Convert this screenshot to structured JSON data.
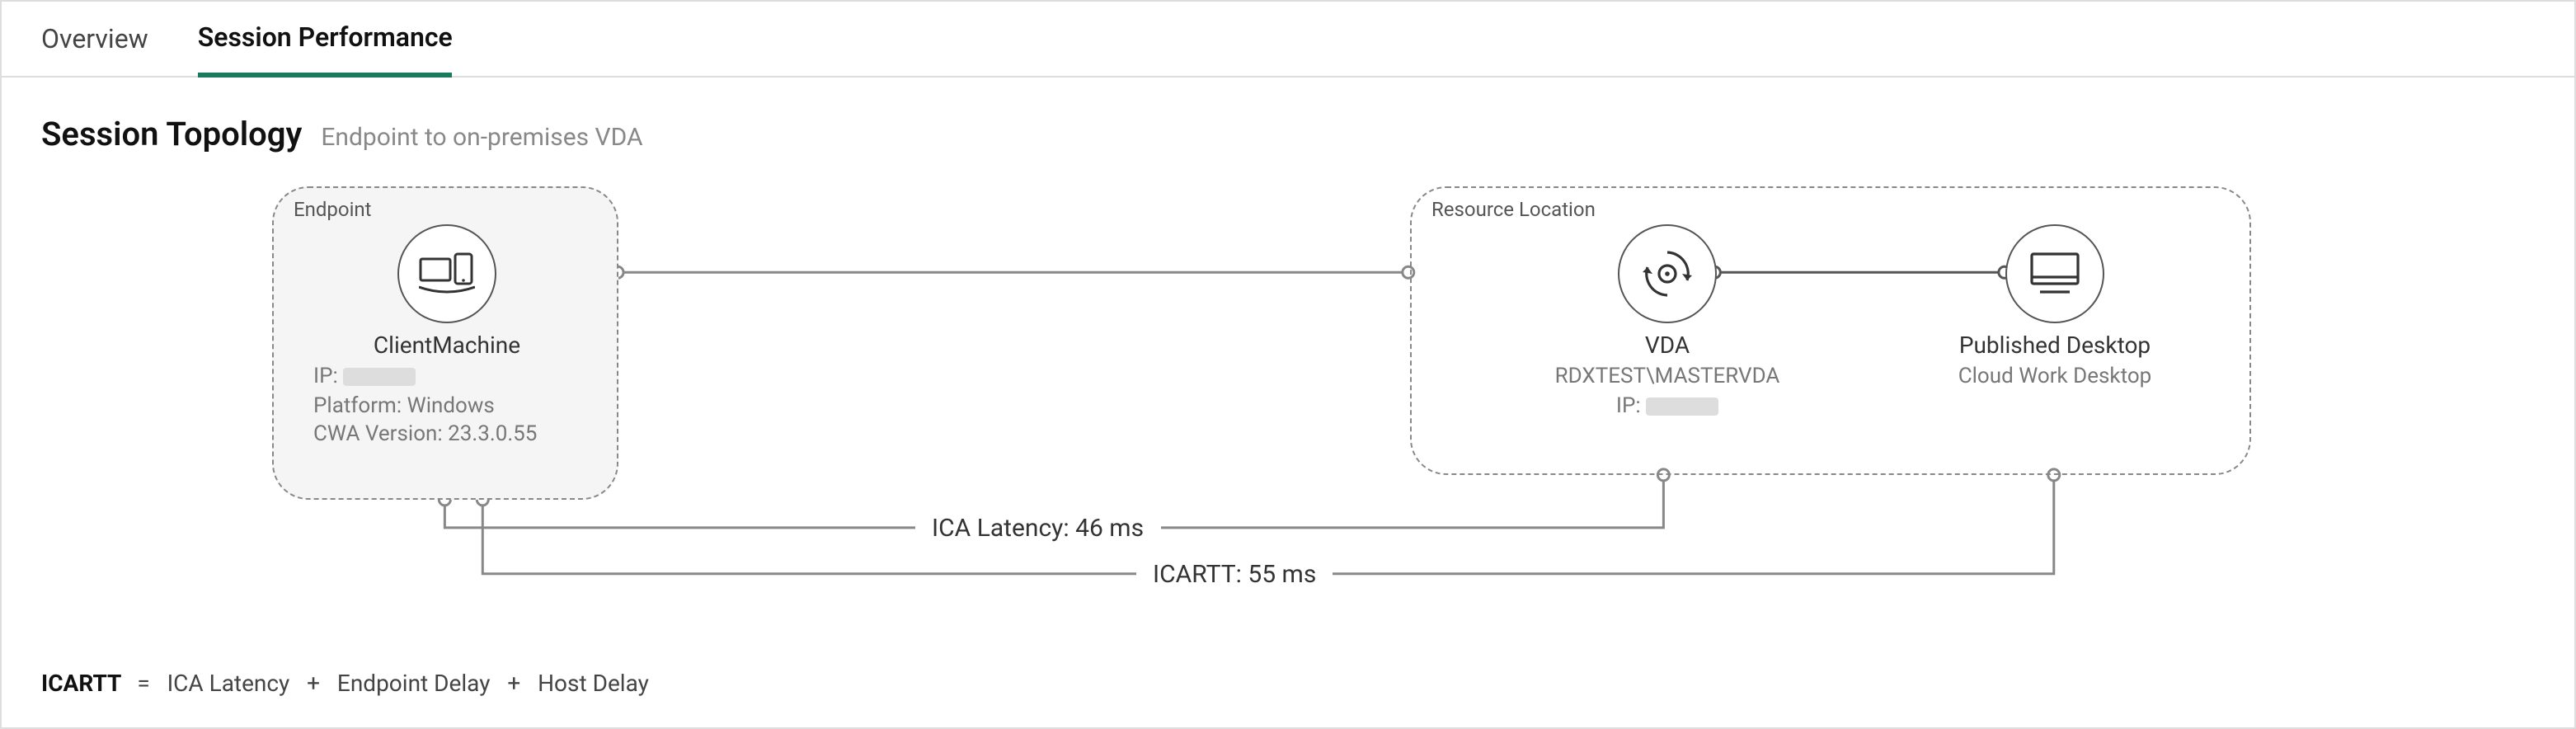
{
  "tabs": {
    "overview": "Overview",
    "session_perf": "Session Performance"
  },
  "section": {
    "title": "Session Topology",
    "subtitle": "Endpoint to on-premises VDA"
  },
  "endpoint": {
    "box_label": "Endpoint",
    "title": "ClientMachine",
    "ip_label": "IP:",
    "platform_label": "Platform:",
    "platform": "Windows",
    "cwa_label": "CWA Version:",
    "cwa": "23.3.0.55"
  },
  "resource": {
    "box_label": "Resource Location",
    "vda": {
      "title": "VDA",
      "machine": "RDXTEST\\MASTERVDA",
      "ip_label": "IP:"
    },
    "published": {
      "title": "Published Desktop",
      "name": "Cloud Work Desktop"
    }
  },
  "metrics": {
    "ica_latency_label": "ICA Latency:",
    "ica_latency_value": "46 ms",
    "icartt_label": "ICARTT:",
    "icartt_value": "55 ms"
  },
  "formula": {
    "lhs": "ICARTT",
    "eq": "=",
    "t1": "ICA Latency",
    "plus1": "+",
    "t2": "Endpoint Delay",
    "plus2": "+",
    "t3": "Host Delay"
  }
}
